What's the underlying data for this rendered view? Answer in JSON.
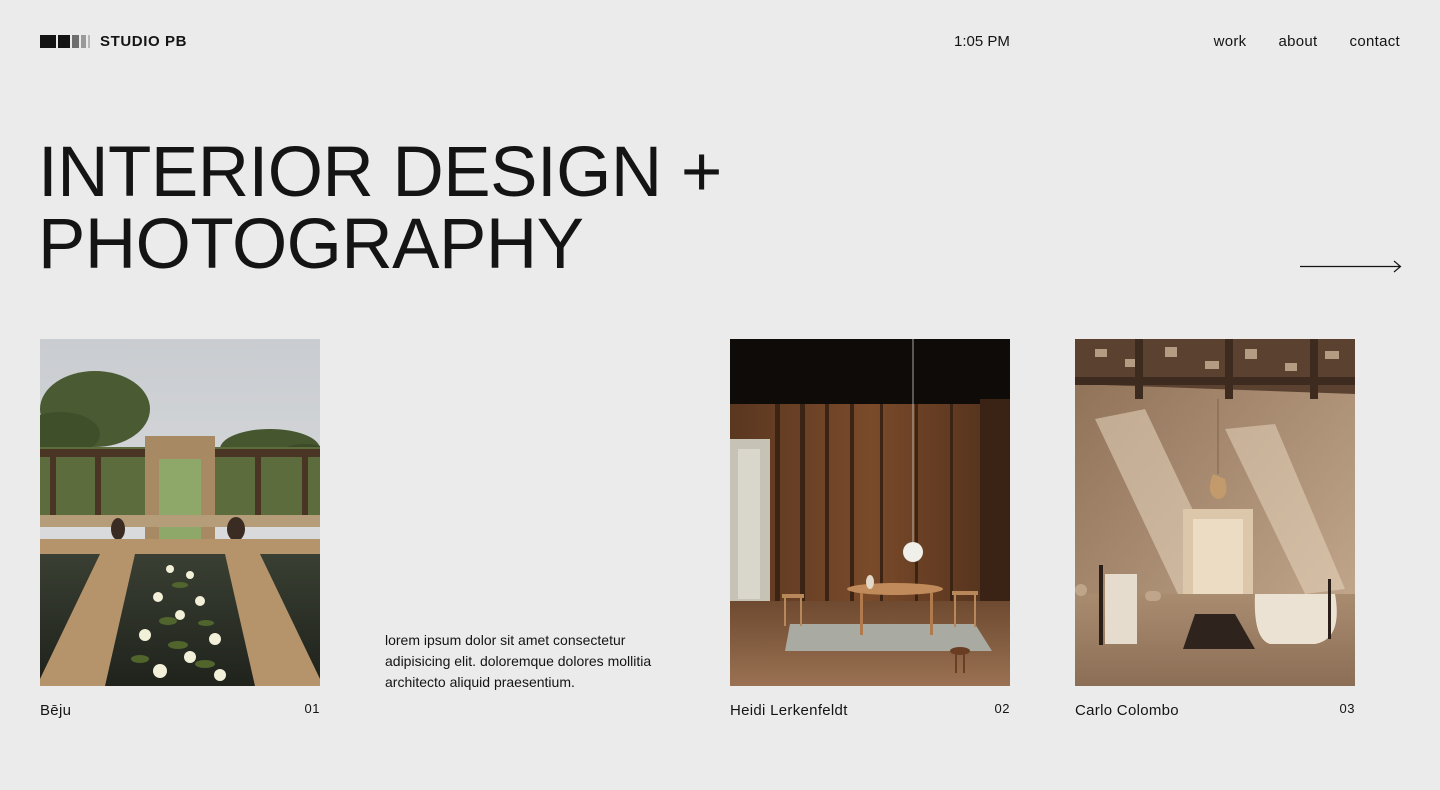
{
  "brand": {
    "name": "STUDIO PB"
  },
  "header": {
    "time": "1:05 PM"
  },
  "nav": {
    "items": [
      "work",
      "about",
      "contact"
    ]
  },
  "hero": {
    "line1": "INTERIOR DESIGN +",
    "line2": "PHOTOGRAPHY"
  },
  "blurb": "lorem ipsum dolor sit amet consectetur adipisicing elit. doloremque dolores mollitia architecto aliquid praesentium.",
  "projects": [
    {
      "name": "Bēju",
      "number": "01"
    },
    {
      "name": "Heidi Lerkenfeldt",
      "number": "02"
    },
    {
      "name": "Carlo Colombo",
      "number": "03"
    }
  ],
  "icons": {
    "logo": "bars-logo-mark",
    "next": "arrow-right-icon"
  }
}
